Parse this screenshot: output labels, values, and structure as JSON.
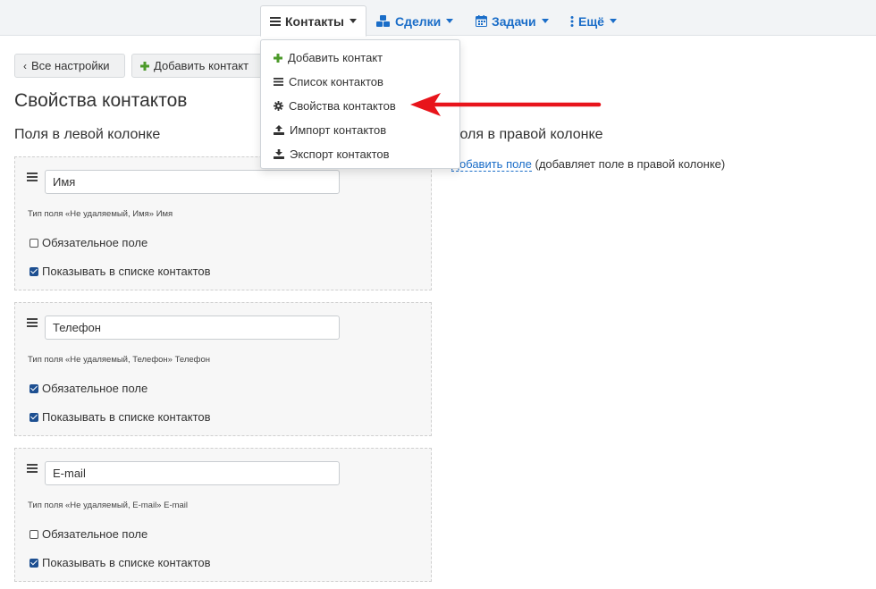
{
  "nav": {
    "contacts_label": "Контакты",
    "deals_label": "Сделки",
    "tasks_label": "Задачи",
    "more_label": "Ещё",
    "link_color": "#1a6dc8"
  },
  "dropdown": {
    "items": [
      {
        "label": "Добавить контакт",
        "icon": "plus-icon"
      },
      {
        "label": "Список контактов",
        "icon": "list-icon"
      },
      {
        "label": "Свойства контактов",
        "icon": "gear-icon"
      },
      {
        "label": "Импорт контактов",
        "icon": "upload-icon"
      },
      {
        "label": "Экспорт контактов",
        "icon": "download-icon"
      }
    ]
  },
  "toolbar": {
    "all_settings_label": "Все настройки",
    "add_contact_label": "Добавить контакт"
  },
  "page": {
    "title": "Свойства контактов",
    "left_column_title": "Поля в левой колонке",
    "right_column_title": "Поля в правой колонке",
    "add_field_link": "Добавить поле",
    "add_field_hint": " (добавляет поле в правой колонке)"
  },
  "fields": [
    {
      "name": "Имя",
      "type_note": "Тип поля «Не удаляемый, Имя» Имя",
      "required_label": "Обязательное поле",
      "required": false,
      "show_label": "Показывать в списке контактов",
      "show": true
    },
    {
      "name": "Телефон",
      "type_note": "Тип поля «Не удаляемый, Телефон» Телефон",
      "required_label": "Обязательное поле",
      "required": true,
      "show_label": "Показывать в списке контактов",
      "show": true
    },
    {
      "name": "E-mail",
      "type_note": "Тип поля «Не удаляемый, E-mail» E-mail",
      "required_label": "Обязательное поле",
      "required": false,
      "show_label": "Показывать в списке контактов",
      "show": true
    }
  ],
  "annotation": {
    "arrow_color": "#e8141b",
    "points_to": "dropdown-item-contact-properties"
  },
  "colors": {
    "plus_green": "#4c9a2a",
    "checkbox_checked": "#1d4f91"
  }
}
